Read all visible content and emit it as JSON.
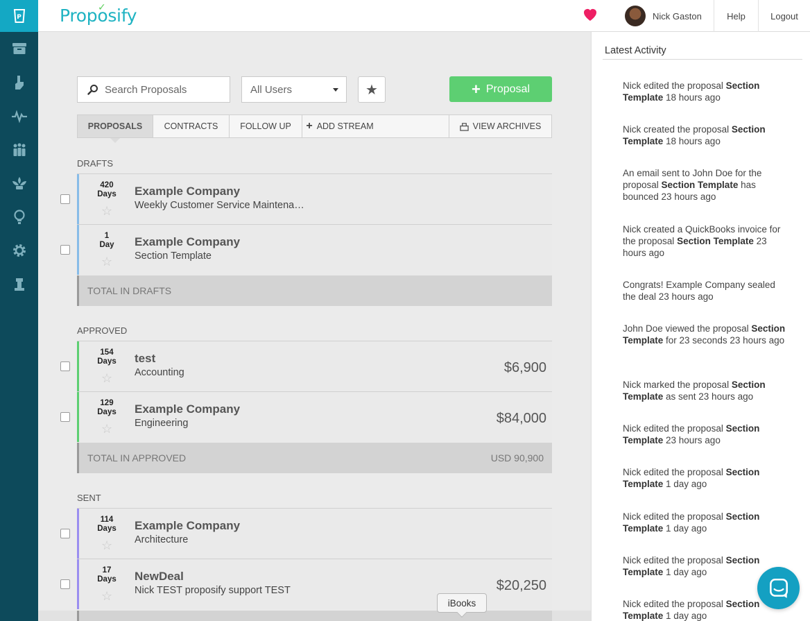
{
  "brand": {
    "name": "Proposify",
    "check": "✓"
  },
  "colors": {
    "rail": "#0d4a5b",
    "accent": "#14a8c4",
    "green": "#5dcf72",
    "draft_bar": "#87bce8",
    "approved_bar": "#5dcf72",
    "sent_bar": "#9b8ef0",
    "heart": "#ee1f64"
  },
  "rail": {
    "icons": [
      "proposify-logo-icon",
      "archive-box-icon",
      "hand-icon",
      "activity-pulse-icon",
      "team-icon",
      "lotus-icon",
      "lightbulb-icon",
      "settings-gear-icon",
      "chess-rook-icon"
    ]
  },
  "header": {
    "user_name": "Nick Gaston",
    "help": "Help",
    "logout": "Logout"
  },
  "toolbar": {
    "search_placeholder": "Search Proposals",
    "users_selected": "All Users",
    "new_proposal": "Proposal"
  },
  "tabs": [
    {
      "label": "Proposals",
      "active": true
    },
    {
      "label": "Contracts"
    },
    {
      "label": "Follow Up"
    },
    {
      "label": "Add Stream"
    },
    {
      "label": "View Archives"
    }
  ],
  "sections": {
    "drafts": {
      "title": "Drafts",
      "rows": [
        {
          "days_num": "420",
          "days_unit": "Days",
          "title": "Example Company",
          "sub": "Weekly Customer Service Maintena…",
          "amount": ""
        },
        {
          "days_num": "1",
          "days_unit": "Day",
          "title": "Example Company",
          "sub": "Section Template",
          "amount": ""
        }
      ],
      "total_label": "Total in Drafts",
      "total_amount": ""
    },
    "approved": {
      "title": "Approved",
      "rows": [
        {
          "days_num": "154",
          "days_unit": "Days",
          "title": "test",
          "sub": "Accounting",
          "amount": "$6,900"
        },
        {
          "days_num": "129",
          "days_unit": "Days",
          "title": "Example Company",
          "sub": "Engineering",
          "amount": "$84,000"
        }
      ],
      "total_label": "Total in Approved",
      "total_amount": "USD 90,900"
    },
    "sent": {
      "title": "Sent",
      "rows": [
        {
          "days_num": "114",
          "days_unit": "Days",
          "title": "Example Company",
          "sub": "Architecture",
          "amount": ""
        },
        {
          "days_num": "17",
          "days_unit": "Days",
          "title": "NewDeal",
          "sub": "Nick TEST proposify support TEST",
          "amount": "$20,250"
        }
      ]
    }
  },
  "activity": {
    "title": "Latest Activity",
    "items": [
      {
        "pre": "Nick edited the proposal ",
        "bold": "Section Template",
        "post": " 18 hours ago"
      },
      {
        "pre": "Nick created the proposal ",
        "bold": "Section Template",
        "post": " 18 hours ago"
      },
      {
        "pre": "An email sent to John Doe for the proposal ",
        "bold": "Section Template",
        "post": " has bounced 23 hours ago"
      },
      {
        "pre": "Nick created a QuickBooks invoice for the proposal ",
        "bold": "Section Template",
        "post": " 23 hours ago"
      },
      {
        "pre": "Congrats! Example Company sealed the deal 23 hours ago",
        "bold": "",
        "post": ""
      },
      {
        "pre": "John Doe viewed the proposal ",
        "bold": "Section Template",
        "post": " for 23 seconds 23 hours ago"
      },
      {
        "pre": "Nick marked the proposal ",
        "bold": "Section Template",
        "post": " as sent 23 hours ago"
      },
      {
        "pre": "Nick edited the proposal ",
        "bold": "Section Template",
        "post": " 23 hours ago"
      },
      {
        "pre": "Nick edited the proposal ",
        "bold": "Section Template",
        "post": " 1 day ago"
      },
      {
        "pre": "Nick edited the proposal ",
        "bold": "Section Template",
        "post": " 1 day ago"
      },
      {
        "pre": "Nick edited the proposal ",
        "bold": "Section Template",
        "post": " 1 day ago"
      },
      {
        "pre": "Nick edited the proposal ",
        "bold": "Section Template",
        "post": " 1 day ago"
      }
    ]
  },
  "tooltip": "iBooks"
}
